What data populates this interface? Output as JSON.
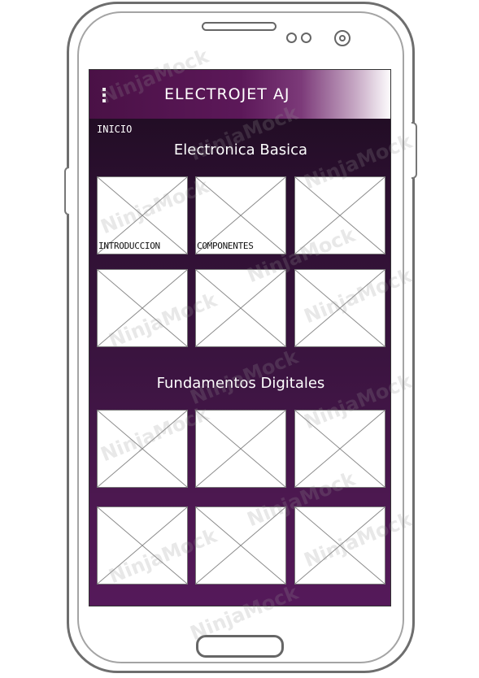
{
  "appbar": {
    "title": "ELECTROJET AJ",
    "menu_icon": "overflow-menu-icon"
  },
  "breadcrumb": "INICIO",
  "sections": [
    {
      "title": "Electronica Basica",
      "tiles": [
        {
          "label": "INTRODUCCION"
        },
        {
          "label": "COMPONENTES"
        },
        {
          "label": ""
        },
        {
          "label": ""
        },
        {
          "label": ""
        },
        {
          "label": ""
        }
      ]
    },
    {
      "title": "Fundamentos Digitales",
      "tiles": [
        {
          "label": ""
        },
        {
          "label": ""
        },
        {
          "label": ""
        },
        {
          "label": ""
        },
        {
          "label": ""
        },
        {
          "label": ""
        }
      ]
    }
  ],
  "watermark": "NinjaMock",
  "colors": {
    "screen_bg": "#2a0f2e",
    "appbar": "#5c1859",
    "tile_bg": "#ffffff"
  }
}
